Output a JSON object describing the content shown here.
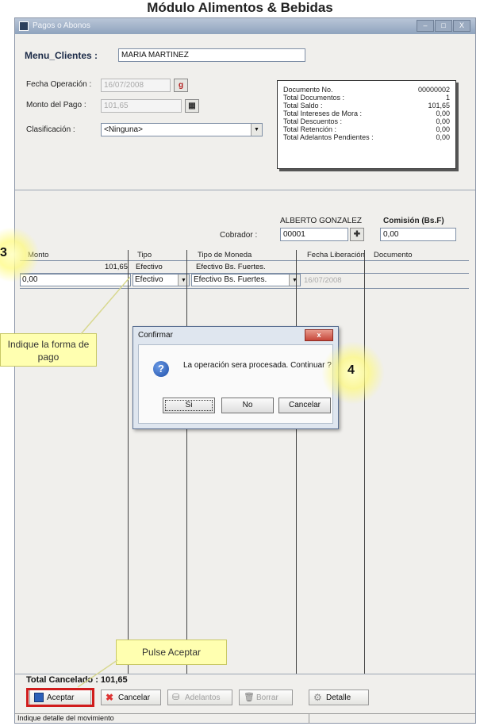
{
  "page": {
    "title": "Módulo Alimentos & Bebidas"
  },
  "window": {
    "title": "Pagos o Abonos",
    "controls": [
      "–",
      "□",
      "X"
    ]
  },
  "form": {
    "menu_label": "Menu_Clientes :",
    "client_name": "MARIA MARTINEZ",
    "fecha_label": "Fecha Operación :",
    "fecha_value": "16/07/2008",
    "monto_label": "Monto del Pago :",
    "monto_value": "101,65",
    "clasificacion_label": "Clasificación :",
    "clasificacion_value": "<Ninguna>"
  },
  "summary": [
    {
      "label": "Documento No.",
      "value": "00000002"
    },
    {
      "label": "Total Documentos :",
      "value": "1"
    },
    {
      "label": "Total Saldo :",
      "value": "101,65"
    },
    {
      "label": "Total Intereses de Mora :",
      "value": "0,00"
    },
    {
      "label": "Total Descuentos :",
      "value": "0,00"
    },
    {
      "label": "Total Retención :",
      "value": "0,00"
    },
    {
      "label": "Total Adelantos Pendientes :",
      "value": "0,00"
    }
  ],
  "cobrador": {
    "label": "Cobrador :",
    "code": "00001",
    "name": "ALBERTO GONZALEZ",
    "comision_label": "Comisión (Bs.F)",
    "comision_value": "0,00"
  },
  "grid": {
    "headers": [
      "Monto",
      "Tipo",
      "Tipo de Moneda",
      "Fecha Liberación",
      "Documento"
    ],
    "rows": [
      {
        "monto": "101,65",
        "tipo": "Efectivo",
        "moneda": "Efectivo Bs. Fuertes.",
        "fecha": "",
        "documento": ""
      },
      {
        "monto": "0,00",
        "tipo": "Efectivo",
        "moneda": "Efectivo Bs. Fuertes.",
        "fecha": "16/07/2008",
        "documento": ""
      }
    ]
  },
  "dialog": {
    "title": "Confirmar",
    "message": "La operación sera procesada. Continuar ?",
    "buttons": [
      "Si",
      "No",
      "Cancelar"
    ]
  },
  "annotations": {
    "step3_num": "3",
    "step3_text": "Indique la forma de pago",
    "step4_num": "4",
    "pulse_text": "Pulse Aceptar"
  },
  "footer": {
    "total_label": "Total Cancelado : 101,65",
    "buttons": [
      "Aceptar",
      "Cancelar",
      "Adelantos",
      "Borrar",
      "Detalle"
    ],
    "status": "Indique detalle del movimiento"
  },
  "colors": {
    "highlight": "#d01c1c",
    "callout": "#ffffb0",
    "titlebar": "#8fa3bd"
  }
}
